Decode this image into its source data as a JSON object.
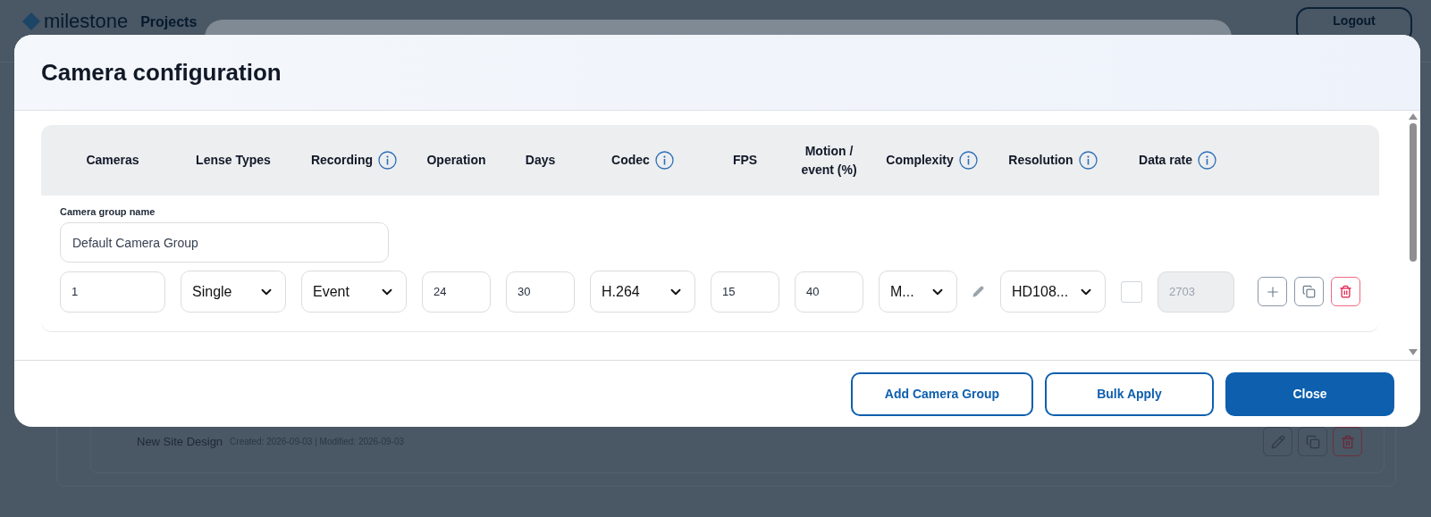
{
  "background_page": {
    "logo": "milestone",
    "nav_item": "Projects",
    "logout_button": "Logout",
    "project": {
      "name": "New Site Design",
      "meta": "Created: 2026-09-03 | Modified: 2026-09-03"
    }
  },
  "dialog": {
    "title": "Camera configuration",
    "columns": [
      {
        "label": "Cameras",
        "info": false
      },
      {
        "label": "Lense Types",
        "info": false
      },
      {
        "label": "Recording",
        "info": true
      },
      {
        "label": "Operation",
        "info": false
      },
      {
        "label": "Days",
        "info": false
      },
      {
        "label": "Codec",
        "info": true
      },
      {
        "label": "FPS",
        "info": false
      },
      {
        "label": "Motion / event (%)",
        "info": false
      },
      {
        "label": "Complexity",
        "info": true
      },
      {
        "label": "Resolution",
        "info": true
      },
      {
        "label": "Data rate",
        "info": true
      }
    ],
    "group_name_label": "Camera group name",
    "group_name_value": "Default Camera Group",
    "fields": [
      {
        "kind": "input",
        "value": "1"
      },
      {
        "kind": "select",
        "value": "Single"
      },
      {
        "kind": "select",
        "value": "Event"
      },
      {
        "kind": "input",
        "value": "24"
      },
      {
        "kind": "input",
        "value": "30"
      },
      {
        "kind": "select",
        "value": "H.264"
      },
      {
        "kind": "input",
        "value": "15"
      },
      {
        "kind": "input",
        "value": "40"
      },
      {
        "kind": "select",
        "value": "M..."
      },
      {
        "kind": "edit"
      },
      {
        "kind": "select",
        "value": "HD108..."
      },
      {
        "kind": "checkbox",
        "checked": false
      },
      {
        "kind": "readonly",
        "value": "2703"
      }
    ],
    "buttons": [
      {
        "label": "Add Camera Group",
        "kind": "outline"
      },
      {
        "label": "Bulk Apply",
        "kind": "outline"
      },
      {
        "label": "Close",
        "kind": "primary"
      }
    ]
  }
}
